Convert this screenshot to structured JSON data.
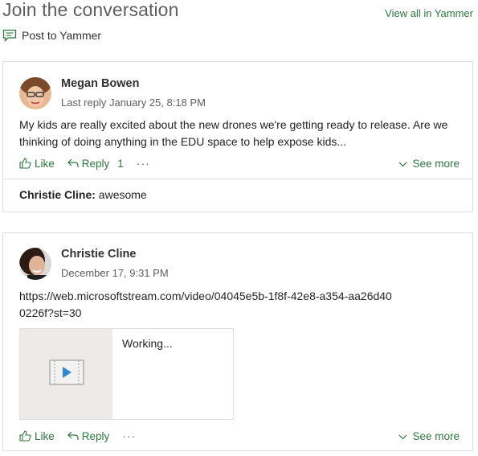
{
  "header": {
    "title": "Join the conversation",
    "view_all": "View all in Yammer",
    "post_label": "Post to Yammer"
  },
  "colors": {
    "link_green": "#2b7a3d",
    "border": "#e1dfdd",
    "muted_text": "#605e5c"
  },
  "threads": [
    {
      "author": "Megan Bowen",
      "meta": "Last reply January 25, 8:18 PM",
      "body": "My kids are really excited about the new drones we're getting ready to release. Are we thinking of doing anything in the EDU space to help expose kids...",
      "actions": {
        "like": "Like",
        "reply": "Reply",
        "reply_count": "1",
        "more": "···",
        "see_more": "See more"
      },
      "latest_reply": {
        "author": "Christie Cline:",
        "text": "awesome"
      }
    },
    {
      "author": "Christie Cline",
      "meta": "December 17, 9:31 PM",
      "body": "https://web.microsoftstream.com/video/04045e5b-1f8f-42e8-a354-aa26d400226f?st=30",
      "attachment": {
        "status": "Working..."
      },
      "actions": {
        "like": "Like",
        "reply": "Reply",
        "more": "···",
        "see_more": "See more"
      }
    }
  ]
}
